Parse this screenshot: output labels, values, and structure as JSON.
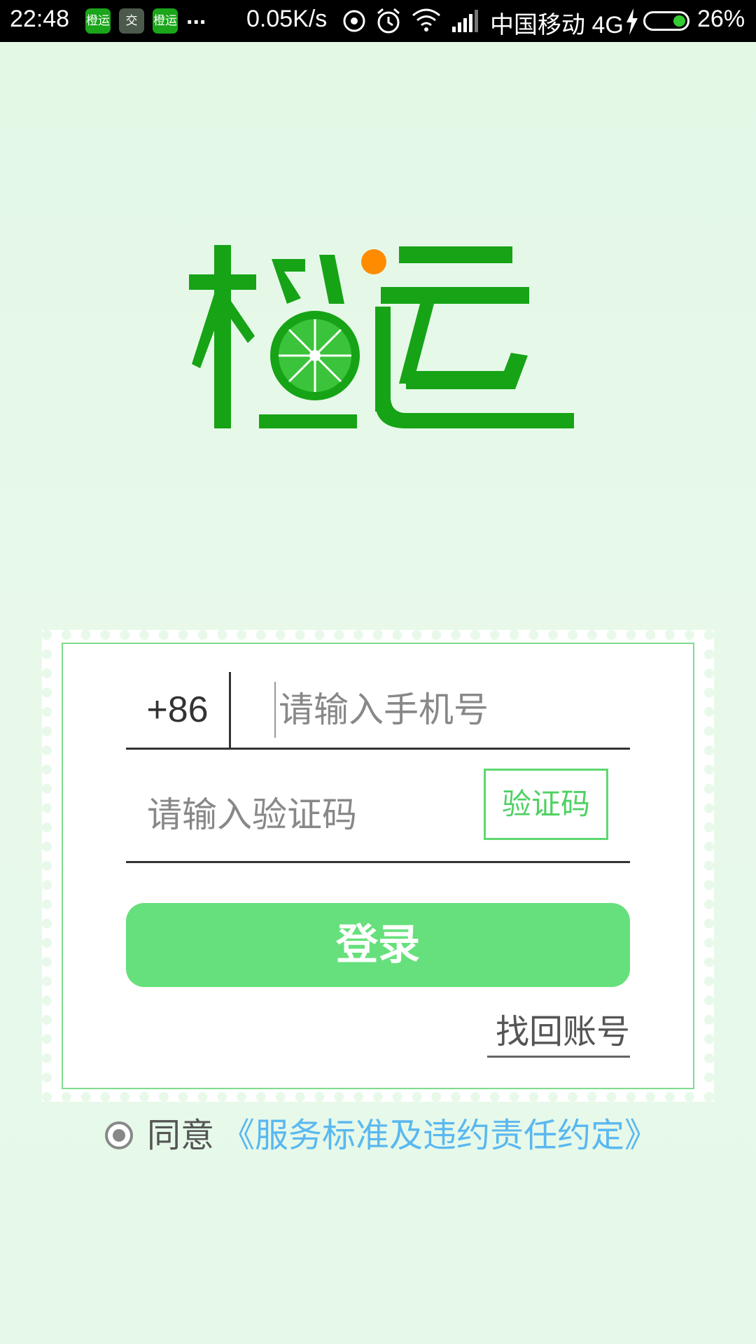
{
  "status_bar": {
    "time": "22:48",
    "notification_icons": [
      "橙运",
      "交",
      "橙运"
    ],
    "more": "...",
    "net_speed": "0.05K/s",
    "carrier": "中国移动 4G",
    "battery_percent": "26%",
    "battery_level": 0.26,
    "icons": [
      "hotspot-icon",
      "alarm-icon",
      "wifi-icon",
      "signal-icon",
      "charging-icon",
      "battery-icon"
    ]
  },
  "logo": {
    "text": "橙运",
    "colors": {
      "primary": "#16a316",
      "accent": "#ff8c00",
      "inner": "#37c237"
    }
  },
  "form": {
    "country_code": "+86",
    "phone_placeholder": "请输入手机号",
    "code_placeholder": "请输入验证码",
    "get_code_label": "验证码",
    "login_label": "登录",
    "recover_label": "找回账号"
  },
  "agreement": {
    "checked": true,
    "label": "同意",
    "link": "《服务标准及违约责任约定》"
  },
  "colors": {
    "background": "#e6f9e9",
    "button": "#66e07c",
    "code_button_border": "#5ed86f",
    "link": "#5ab8f0",
    "card_border": "#7ddc8c"
  }
}
